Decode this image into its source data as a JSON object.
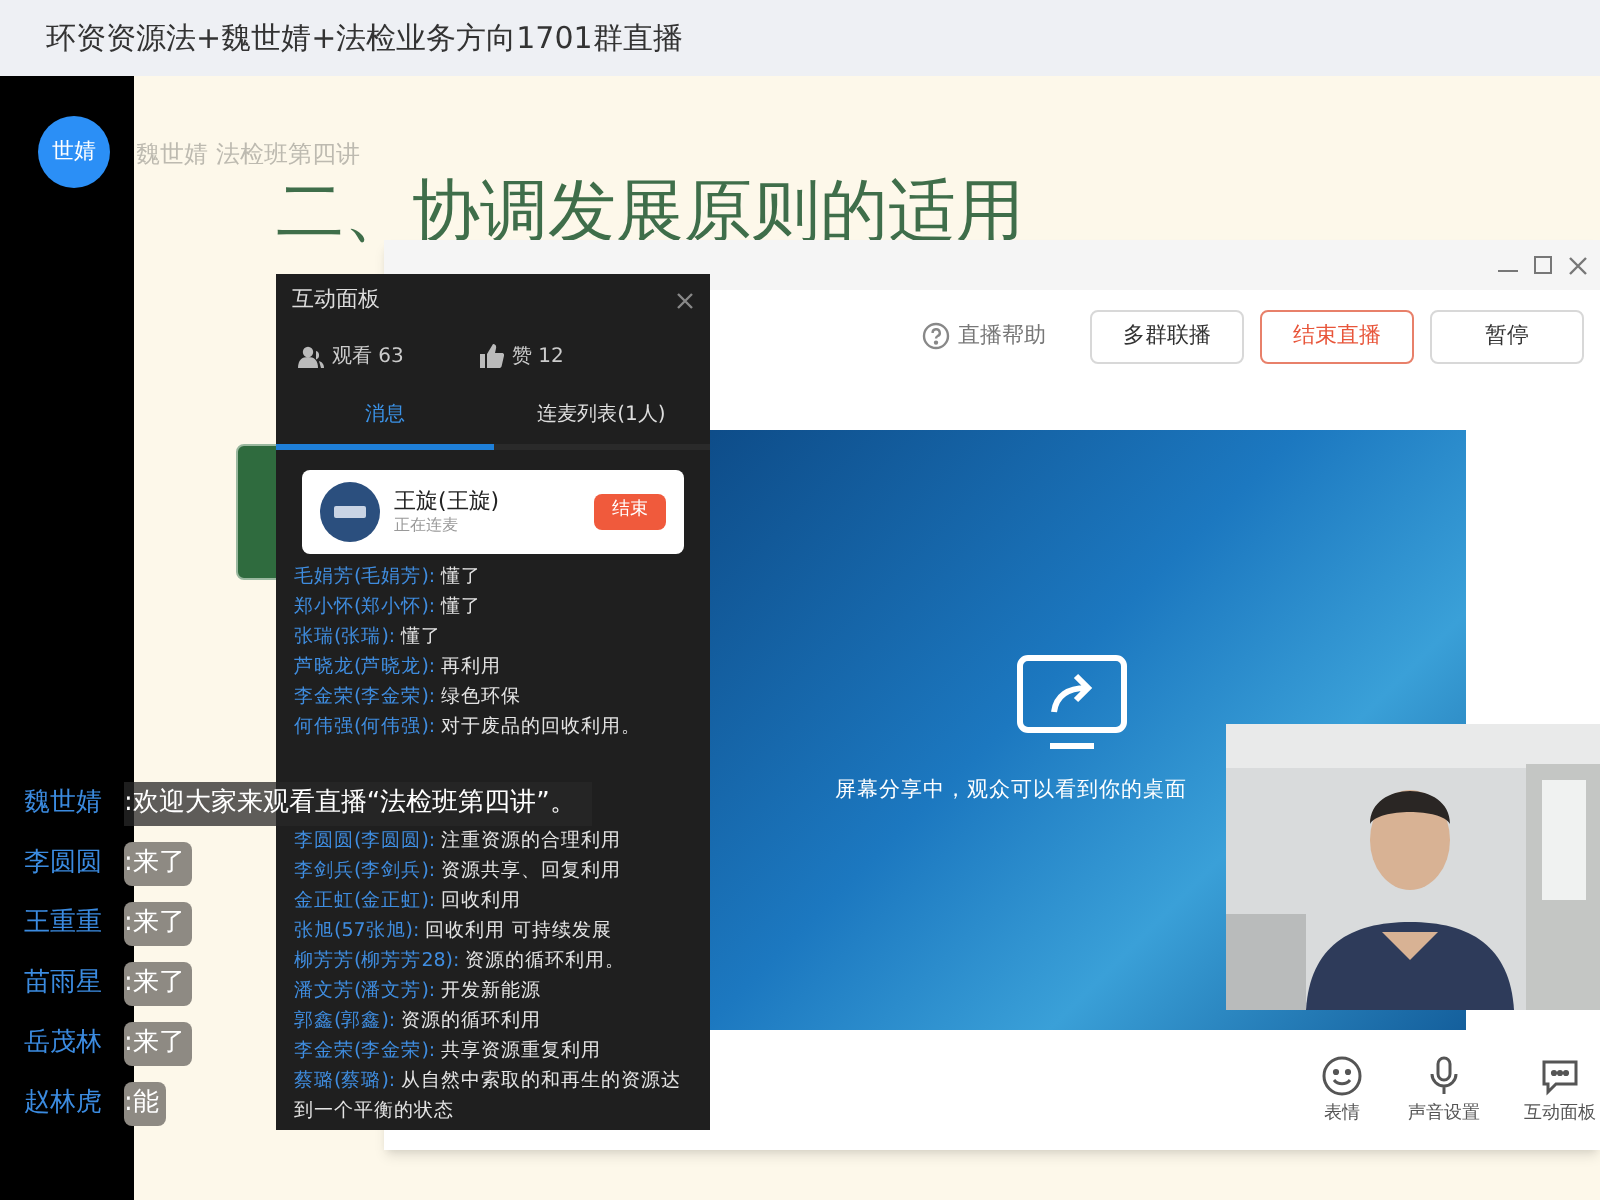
{
  "window": {
    "title": "环资资源法+魏世婧+法检业务方向1701群直播"
  },
  "presenter": {
    "avatar_text": "世婧",
    "caption": "魏世婧 法检班第四讲"
  },
  "slide": {
    "heading": "二、协调发展原则的适用"
  },
  "live_window": {
    "help": "直播帮助",
    "buttons": [
      {
        "label": "多群联播",
        "kind": "normal"
      },
      {
        "label": "结束直播",
        "kind": "danger"
      },
      {
        "label": "暂停",
        "kind": "normal"
      }
    ],
    "share_status": "屏幕分享中，观众可以看到你的桌面",
    "bottom_tools": [
      {
        "label": "表情",
        "kind": "emoji"
      },
      {
        "label": "声音设置",
        "kind": "mic"
      },
      {
        "label": "互动面板",
        "kind": "chat"
      }
    ]
  },
  "panel": {
    "title": "互动面板",
    "views": "观看 63",
    "likes": "赞 12",
    "tabs": [
      {
        "label": "消息",
        "selected": true
      },
      {
        "label": "连麦列表(1人)",
        "selected": false
      }
    ],
    "co_host": {
      "name": "王旋(王旋)",
      "status": "正在连麦",
      "button": "结束"
    },
    "messages": [
      {
        "user": "毛娟芳(毛娟芳):",
        "text": "懂了"
      },
      {
        "user": "郑小怀(郑小怀):",
        "text": "懂了"
      },
      {
        "user": "张瑞(张瑞):",
        "text": "懂了"
      },
      {
        "user": "芦晓龙(芦晓龙):",
        "text": "再利用"
      },
      {
        "user": "李金荣(李金荣):",
        "text": "绿色环保"
      },
      {
        "user": "何伟强(何伟强):",
        "text": "对于废品的回收利用。"
      },
      {
        "user": "李圆圆(李圆圆):",
        "text": "注重资源的合理利用"
      },
      {
        "user": "李剑兵(李剑兵):",
        "text": "资源共享、回复利用"
      },
      {
        "user": "金正虹(金正虹):",
        "text": "回收利用"
      },
      {
        "user": "张旭(57张旭):",
        "text": "回收利用  可持续发展"
      },
      {
        "user": "柳芳芳(柳芳芳28):",
        "text": "资源的循环利用。"
      },
      {
        "user": "潘文芳(潘文芳):",
        "text": "开发新能源"
      },
      {
        "user": "郭鑫(郭鑫):",
        "text": "资源的循环利用"
      },
      {
        "user": "李金荣(李金荣):",
        "text": "共享资源重复利用"
      },
      {
        "user": "蔡璐(蔡璐):",
        "text": "从自然中索取的和再生的资源达到一个平衡的状态"
      }
    ]
  },
  "overlay_chat": [
    {
      "user": "魏世婧",
      "text": ":欢迎大家来观看直播“法检班第四讲”。",
      "kind": "banner"
    },
    {
      "user": "李圆圆",
      "text": ":来了",
      "kind": "pill"
    },
    {
      "user": "王重重",
      "text": ":来了",
      "kind": "pill"
    },
    {
      "user": "苗雨星",
      "text": ":来了",
      "kind": "pill"
    },
    {
      "user": "岳茂林",
      "text": ":来了",
      "kind": "pill"
    },
    {
      "user": "赵林虎",
      "text": ":能",
      "kind": "pill"
    }
  ]
}
